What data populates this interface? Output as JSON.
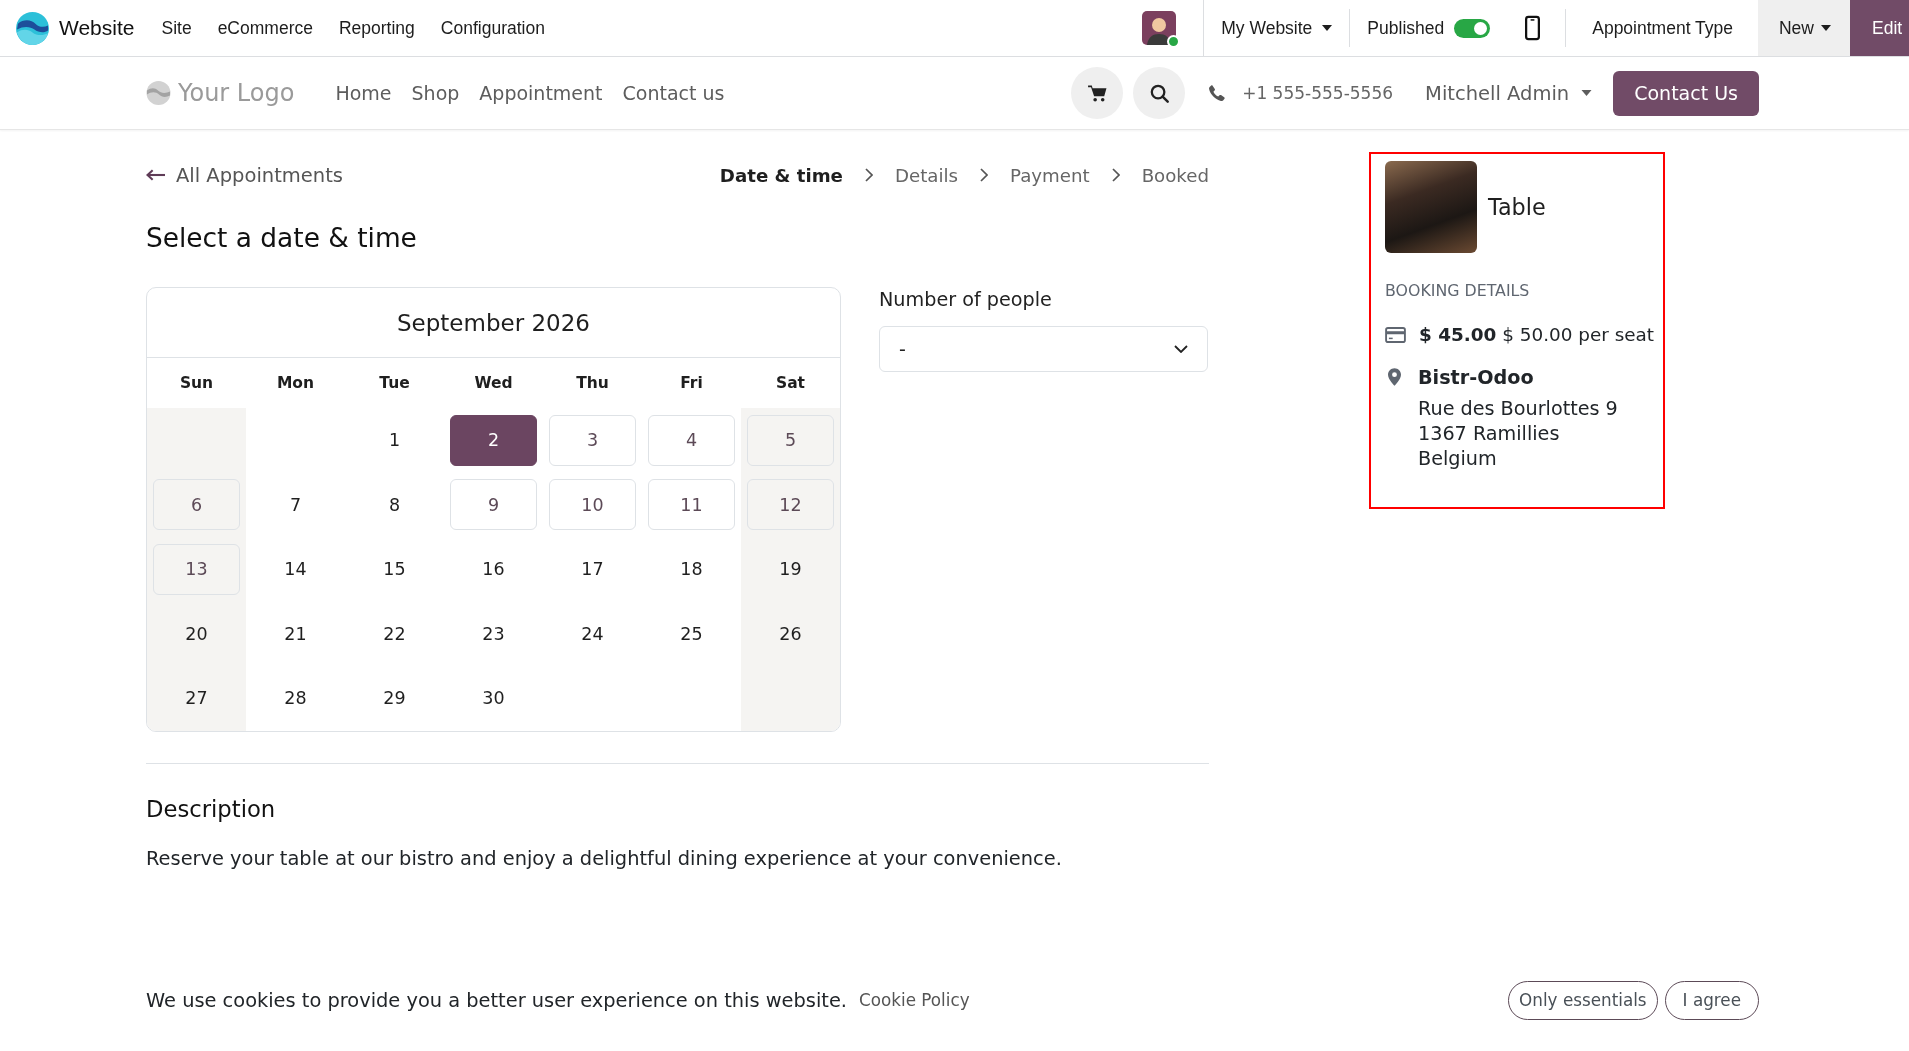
{
  "top_bar": {
    "app_name": "Website",
    "menu": [
      "Site",
      "eCommerce",
      "Reporting",
      "Configuration"
    ],
    "website_menu": "My Website",
    "published": {
      "label": "Published",
      "on": true
    },
    "appointment_type": "Appointment Type",
    "new_button": "New",
    "edit_button": "Edit"
  },
  "site_header": {
    "logo": "Your Logo",
    "nav": [
      "Home",
      "Shop",
      "Appointment",
      "Contact us"
    ],
    "phone": "+1 555-555-5556",
    "user_menu": "Mitchell Admin",
    "contact_button": "Contact Us"
  },
  "back_link": "All Appointments",
  "steps": [
    {
      "label": "Date & time",
      "selected": true
    },
    {
      "label": "Details",
      "selected": false
    },
    {
      "label": "Payment",
      "selected": false
    },
    {
      "label": "Booked",
      "selected": false
    }
  ],
  "title": "Select a date & time",
  "calendar": {
    "month": "September 2026",
    "weekdays": [
      {
        "label": "Sun",
        "weekend": true
      },
      {
        "label": "Mon",
        "weekend": false
      },
      {
        "label": "Tue",
        "weekend": false
      },
      {
        "label": "Wed",
        "weekend": false
      },
      {
        "label": "Thu",
        "weekend": false
      },
      {
        "label": "Fri",
        "weekend": false
      },
      {
        "label": "Sat",
        "weekend": true
      }
    ],
    "days": [
      {
        "kind": "blank"
      },
      {
        "kind": "blank"
      },
      {
        "label": "1",
        "kind": "closed",
        "selected": false
      },
      {
        "label": "2",
        "kind": "open",
        "selected": true
      },
      {
        "label": "3",
        "kind": "open",
        "selected": false
      },
      {
        "label": "4",
        "kind": "open",
        "selected": false
      },
      {
        "label": "5",
        "kind": "open",
        "selected": false
      },
      {
        "label": "6",
        "kind": "open",
        "selected": false
      },
      {
        "label": "7",
        "kind": "closed",
        "selected": false
      },
      {
        "label": "8",
        "kind": "closed",
        "selected": false
      },
      {
        "label": "9",
        "kind": "open",
        "selected": false
      },
      {
        "label": "10",
        "kind": "open",
        "selected": false
      },
      {
        "label": "11",
        "kind": "open",
        "selected": false
      },
      {
        "label": "12",
        "kind": "open",
        "selected": false
      },
      {
        "label": "13",
        "kind": "open",
        "selected": false
      },
      {
        "label": "14",
        "kind": "closed",
        "selected": false
      },
      {
        "label": "15",
        "kind": "closed",
        "selected": false
      },
      {
        "label": "16",
        "kind": "closed",
        "selected": false
      },
      {
        "label": "17",
        "kind": "closed",
        "selected": false
      },
      {
        "label": "18",
        "kind": "closed",
        "selected": false
      },
      {
        "label": "19",
        "kind": "closed",
        "selected": false
      },
      {
        "label": "20",
        "kind": "closed",
        "selected": false
      },
      {
        "label": "21",
        "kind": "closed",
        "selected": false
      },
      {
        "label": "22",
        "kind": "closed",
        "selected": false
      },
      {
        "label": "23",
        "kind": "closed",
        "selected": false
      },
      {
        "label": "24",
        "kind": "closed",
        "selected": false
      },
      {
        "label": "25",
        "kind": "closed",
        "selected": false
      },
      {
        "label": "26",
        "kind": "closed",
        "selected": false
      },
      {
        "label": "27",
        "kind": "closed",
        "selected": false
      },
      {
        "label": "28",
        "kind": "closed",
        "selected": false
      },
      {
        "label": "29",
        "kind": "closed",
        "selected": false
      },
      {
        "label": "30",
        "kind": "closed",
        "selected": false
      },
      {
        "kind": "blank"
      },
      {
        "kind": "blank"
      },
      {
        "kind": "blank"
      }
    ]
  },
  "people": {
    "label": "Number of people",
    "value": "-"
  },
  "description": {
    "title": "Description",
    "text": "Reserve your table at our bistro and enjoy a delightful dining experience at your convenience."
  },
  "booking": {
    "highlighted": true,
    "name": "Table",
    "section": "BOOKING DETAILS",
    "price_line": "**$ 45.00** $ 50.00 per seat",
    "location": "Bistr-Odoo",
    "address": [
      "Rue des Bourlottes 9",
      "1367 Ramillies",
      "Belgium"
    ]
  },
  "cookie_bar": {
    "text": "We use cookies to provide you a better user experience on this website.",
    "link": "Cookie Policy",
    "buttons": [
      "Only essentials",
      "I agree"
    ]
  }
}
